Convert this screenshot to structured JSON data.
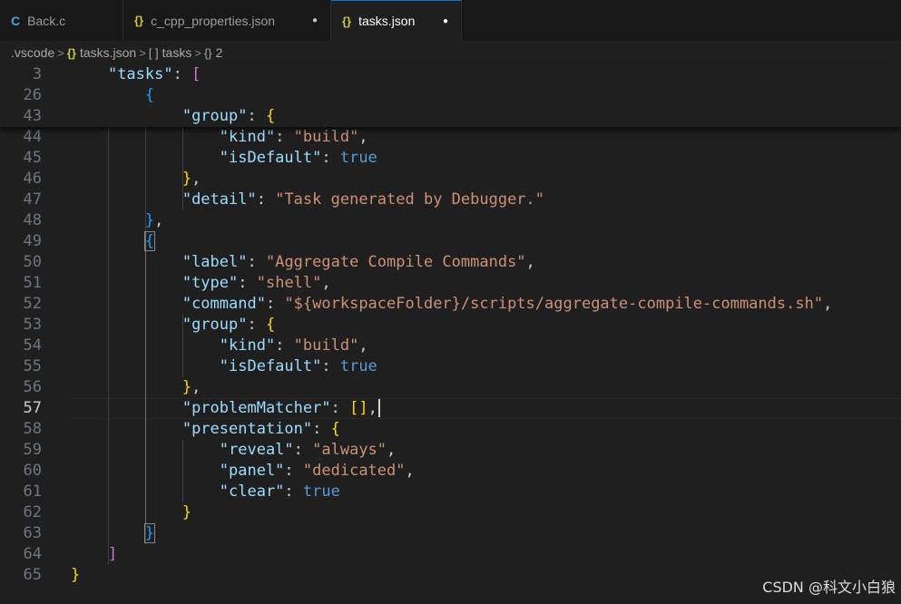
{
  "tabs": [
    {
      "icon": "C",
      "label": "Back.c",
      "active": false,
      "dirty": false
    },
    {
      "icon": "{}",
      "label": "c_cpp_properties.json",
      "active": false,
      "dirty": true
    },
    {
      "icon": "{}",
      "label": "tasks.json",
      "active": true,
      "dirty": true
    }
  ],
  "tab_dot": "●",
  "breadcrumb": {
    "folder": ".vscode",
    "file_icon": "{}",
    "file": "tasks.json",
    "array_icon": "[ ]",
    "array": "tasks",
    "object_icon": "{}",
    "object": "2",
    "separator": ">"
  },
  "sticky": [
    {
      "n": "3",
      "tokens": [
        [
          "",
          "    "
        ],
        [
          "key",
          "\"tasks\""
        ],
        [
          "p",
          ": "
        ],
        [
          "b2",
          "["
        ]
      ]
    },
    {
      "n": "26",
      "tokens": [
        [
          "",
          "        "
        ],
        [
          "b3",
          "{"
        ]
      ]
    },
    {
      "n": "43",
      "tokens": [
        [
          "",
          "            "
        ],
        [
          "key",
          "\"group\""
        ],
        [
          "p",
          ": "
        ],
        [
          "b1",
          "{"
        ]
      ]
    }
  ],
  "lines": [
    {
      "n": "44",
      "tokens": [
        [
          "",
          "                "
        ],
        [
          "key",
          "\"kind\""
        ],
        [
          "p",
          ": "
        ],
        [
          "str",
          "\"build\""
        ],
        [
          "p",
          ","
        ]
      ]
    },
    {
      "n": "45",
      "tokens": [
        [
          "",
          "                "
        ],
        [
          "key",
          "\"isDefault\""
        ],
        [
          "p",
          ": "
        ],
        [
          "bool",
          "true"
        ]
      ]
    },
    {
      "n": "46",
      "tokens": [
        [
          "",
          "            "
        ],
        [
          "b1",
          "}"
        ],
        [
          "p",
          ","
        ]
      ]
    },
    {
      "n": "47",
      "tokens": [
        [
          "",
          "            "
        ],
        [
          "key",
          "\"detail\""
        ],
        [
          "p",
          ": "
        ],
        [
          "str",
          "\"Task generated by Debugger.\""
        ]
      ]
    },
    {
      "n": "48",
      "tokens": [
        [
          "",
          "        "
        ],
        [
          "b3",
          "}"
        ],
        [
          "p",
          ","
        ]
      ]
    },
    {
      "n": "49",
      "tokens": [
        [
          "",
          "        "
        ],
        [
          "b3 box",
          "{"
        ]
      ]
    },
    {
      "n": "50",
      "tokens": [
        [
          "",
          "            "
        ],
        [
          "key",
          "\"label\""
        ],
        [
          "p",
          ": "
        ],
        [
          "str",
          "\"Aggregate Compile Commands\""
        ],
        [
          "p",
          ","
        ]
      ]
    },
    {
      "n": "51",
      "tokens": [
        [
          "",
          "            "
        ],
        [
          "key",
          "\"type\""
        ],
        [
          "p",
          ": "
        ],
        [
          "str",
          "\"shell\""
        ],
        [
          "p",
          ","
        ]
      ]
    },
    {
      "n": "52",
      "tokens": [
        [
          "",
          "            "
        ],
        [
          "key",
          "\"command\""
        ],
        [
          "p",
          ": "
        ],
        [
          "str",
          "\"${workspaceFolder}/scripts/aggregate-compile-commands.sh\""
        ],
        [
          "p",
          ","
        ]
      ]
    },
    {
      "n": "53",
      "tokens": [
        [
          "",
          "            "
        ],
        [
          "key",
          "\"group\""
        ],
        [
          "p",
          ": "
        ],
        [
          "b1",
          "{"
        ]
      ]
    },
    {
      "n": "54",
      "tokens": [
        [
          "",
          "                "
        ],
        [
          "key",
          "\"kind\""
        ],
        [
          "p",
          ": "
        ],
        [
          "str",
          "\"build\""
        ],
        [
          "p",
          ","
        ]
      ]
    },
    {
      "n": "55",
      "tokens": [
        [
          "",
          "                "
        ],
        [
          "key",
          "\"isDefault\""
        ],
        [
          "p",
          ": "
        ],
        [
          "bool",
          "true"
        ]
      ]
    },
    {
      "n": "56",
      "tokens": [
        [
          "",
          "            "
        ],
        [
          "b1",
          "}"
        ],
        [
          "p",
          ","
        ]
      ]
    },
    {
      "n": "57",
      "tokens": [
        [
          "",
          "            "
        ],
        [
          "key",
          "\"problemMatcher\""
        ],
        [
          "p",
          ": "
        ],
        [
          "b1",
          "[]"
        ],
        [
          "p",
          ","
        ]
      ]
    },
    {
      "n": "58",
      "tokens": [
        [
          "",
          "            "
        ],
        [
          "key",
          "\"presentation\""
        ],
        [
          "p",
          ": "
        ],
        [
          "b1",
          "{"
        ]
      ]
    },
    {
      "n": "59",
      "tokens": [
        [
          "",
          "                "
        ],
        [
          "key",
          "\"reveal\""
        ],
        [
          "p",
          ": "
        ],
        [
          "str",
          "\"always\""
        ],
        [
          "p",
          ","
        ]
      ]
    },
    {
      "n": "60",
      "tokens": [
        [
          "",
          "                "
        ],
        [
          "key",
          "\"panel\""
        ],
        [
          "p",
          ": "
        ],
        [
          "str",
          "\"dedicated\""
        ],
        [
          "p",
          ","
        ]
      ]
    },
    {
      "n": "61",
      "tokens": [
        [
          "",
          "                "
        ],
        [
          "key",
          "\"clear\""
        ],
        [
          "p",
          ": "
        ],
        [
          "bool",
          "true"
        ]
      ]
    },
    {
      "n": "62",
      "tokens": [
        [
          "",
          "            "
        ],
        [
          "b1",
          "}"
        ]
      ]
    },
    {
      "n": "63",
      "tokens": [
        [
          "",
          "        "
        ],
        [
          "b3 box",
          "}"
        ]
      ]
    },
    {
      "n": "64",
      "tokens": [
        [
          "",
          "    "
        ],
        [
          "b2",
          "]"
        ]
      ]
    },
    {
      "n": "65",
      "tokens": [
        [
          "b1",
          "}"
        ]
      ]
    }
  ],
  "cursor_line": "57",
  "watermark": "CSDN @科文小白狼"
}
